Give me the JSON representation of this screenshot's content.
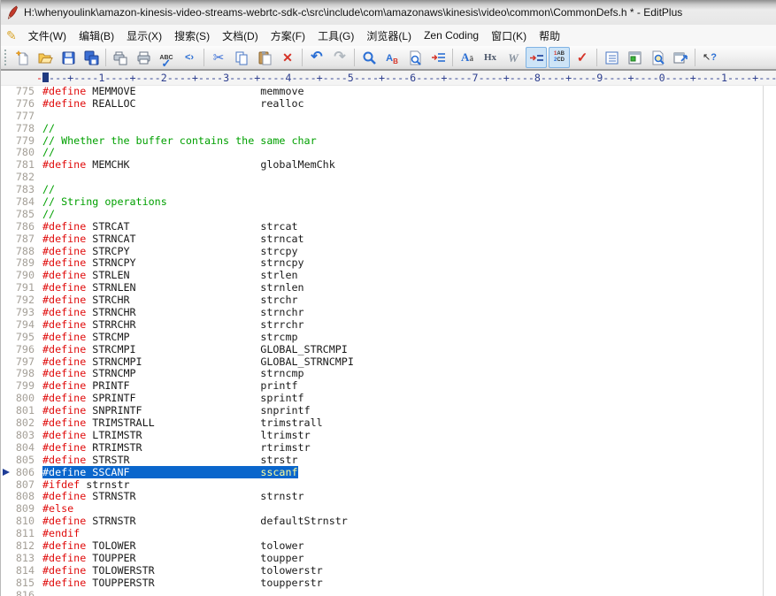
{
  "window": {
    "title": "H:\\whenyoulink\\amazon-kinesis-video-streams-webrtc-sdk-c\\src\\include\\com\\amazonaws\\kinesis\\video\\common\\CommonDefs.h * - EditPlus"
  },
  "menu": {
    "items": [
      {
        "id": "file",
        "label": "文件(W)"
      },
      {
        "id": "edit",
        "label": "编辑(B)"
      },
      {
        "id": "view",
        "label": "显示(X)"
      },
      {
        "id": "search",
        "label": "搜索(S)"
      },
      {
        "id": "document",
        "label": "文档(D)"
      },
      {
        "id": "project",
        "label": "方案(F)"
      },
      {
        "id": "tools",
        "label": "工具(G)"
      },
      {
        "id": "browser",
        "label": "浏览器(L)"
      },
      {
        "id": "zen-coding",
        "label": "Zen Coding"
      },
      {
        "id": "window",
        "label": "窗口(K)"
      },
      {
        "id": "help",
        "label": "帮助"
      }
    ]
  },
  "toolbar": {
    "groups": [
      [
        "new-file",
        "open-file",
        "save",
        "save-all"
      ],
      [
        "print-preview",
        "print",
        "spell-check",
        "view-in-browser"
      ],
      [
        "cut",
        "copy",
        "paste",
        "delete"
      ],
      [
        "undo",
        "redo"
      ],
      [
        "find",
        "replace",
        "find-in-files",
        "goto-line"
      ],
      [
        "convert-case",
        "hex-viewer",
        "word-wrap",
        "auto-indent",
        "line-numbers",
        "mark"
      ],
      [
        "document-list",
        "html-toolbar",
        "preview",
        "open-external"
      ],
      [
        "context-help"
      ]
    ],
    "toggled": [
      "auto-indent",
      "line-numbers"
    ],
    "disabled": [
      "redo"
    ]
  },
  "ruler": {
    "pattern": "---+----1----+----2----+----3----+----4----+----5----+----6----+----7----+----8----+----9----+----0----+----1----+----"
  },
  "editor": {
    "value_column": 36,
    "lines": [
      {
        "num": "775",
        "directive": "#define",
        "name": "MEMMOVE",
        "value": "memmove"
      },
      {
        "num": "776",
        "directive": "#define",
        "name": "REALLOC",
        "value": "realloc"
      },
      {
        "num": "777"
      },
      {
        "num": "778",
        "comment": "//"
      },
      {
        "num": "779",
        "comment": "// Whether the buffer contains the same char"
      },
      {
        "num": "780",
        "comment": "//"
      },
      {
        "num": "781",
        "directive": "#define",
        "name": "MEMCHK",
        "value": "globalMemChk"
      },
      {
        "num": "782"
      },
      {
        "num": "783",
        "comment": "//"
      },
      {
        "num": "784",
        "comment": "// String operations"
      },
      {
        "num": "785",
        "comment": "//"
      },
      {
        "num": "786",
        "directive": "#define",
        "name": "STRCAT",
        "value": "strcat"
      },
      {
        "num": "787",
        "directive": "#define",
        "name": "STRNCAT",
        "value": "strncat"
      },
      {
        "num": "788",
        "directive": "#define",
        "name": "STRCPY",
        "value": "strcpy"
      },
      {
        "num": "789",
        "directive": "#define",
        "name": "STRNCPY",
        "value": "strncpy"
      },
      {
        "num": "790",
        "directive": "#define",
        "name": "STRLEN",
        "value": "strlen"
      },
      {
        "num": "791",
        "directive": "#define",
        "name": "STRNLEN",
        "value": "strnlen"
      },
      {
        "num": "792",
        "directive": "#define",
        "name": "STRCHR",
        "value": "strchr"
      },
      {
        "num": "793",
        "directive": "#define",
        "name": "STRNCHR",
        "value": "strnchr"
      },
      {
        "num": "794",
        "directive": "#define",
        "name": "STRRCHR",
        "value": "strrchr"
      },
      {
        "num": "795",
        "directive": "#define",
        "name": "STRCMP",
        "value": "strcmp"
      },
      {
        "num": "796",
        "directive": "#define",
        "name": "STRCMPI",
        "value": "GLOBAL_STRCMPI"
      },
      {
        "num": "797",
        "directive": "#define",
        "name": "STRNCMPI",
        "value": "GLOBAL_STRNCMPI"
      },
      {
        "num": "798",
        "directive": "#define",
        "name": "STRNCMP",
        "value": "strncmp"
      },
      {
        "num": "799",
        "directive": "#define",
        "name": "PRINTF",
        "value": "printf"
      },
      {
        "num": "800",
        "directive": "#define",
        "name": "SPRINTF",
        "value": "sprintf"
      },
      {
        "num": "801",
        "directive": "#define",
        "name": "SNPRINTF",
        "value": "snprintf"
      },
      {
        "num": "802",
        "directive": "#define",
        "name": "TRIMSTRALL",
        "value": "trimstrall"
      },
      {
        "num": "803",
        "directive": "#define",
        "name": "LTRIMSTR",
        "value": "ltrimstr"
      },
      {
        "num": "804",
        "directive": "#define",
        "name": "RTRIMSTR",
        "value": "rtrimstr"
      },
      {
        "num": "805",
        "directive": "#define",
        "name": "STRSTR",
        "value": "strstr"
      },
      {
        "num": "806",
        "directive": "#define",
        "name": "SSCANF",
        "value": "sscanf",
        "selected": true
      },
      {
        "num": "807",
        "directive": "#ifdef",
        "name": "strnstr"
      },
      {
        "num": "808",
        "directive": "#define",
        "name": "STRNSTR",
        "value": "strnstr"
      },
      {
        "num": "809",
        "directive": "#else"
      },
      {
        "num": "810",
        "directive": "#define",
        "name": "STRNSTR",
        "value": "defaultStrnstr"
      },
      {
        "num": "811",
        "directive": "#endif"
      },
      {
        "num": "812",
        "directive": "#define",
        "name": "TOLOWER",
        "value": "tolower"
      },
      {
        "num": "813",
        "directive": "#define",
        "name": "TOUPPER",
        "value": "toupper"
      },
      {
        "num": "814",
        "directive": "#define",
        "name": "TOLOWERSTR",
        "value": "tolowerstr"
      },
      {
        "num": "815",
        "directive": "#define",
        "name": "TOUPPERSTR",
        "value": "toupperstr"
      },
      {
        "num": "816"
      }
    ]
  },
  "colors": {
    "directive": "#e00d0d",
    "comment": "#00a000",
    "selection_bg": "#0a66cc",
    "selection_text": "#ffffff",
    "selection_value": "#ffff9c",
    "line_number": "#a5a098",
    "ruler_text": "#2e3f8f"
  }
}
